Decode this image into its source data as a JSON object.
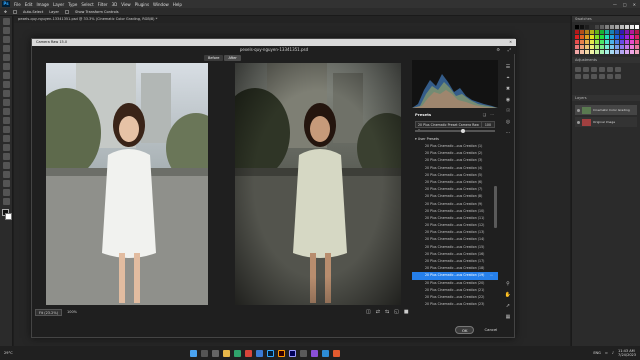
{
  "menu": {
    "logo": "Ps",
    "items": [
      "File",
      "Edit",
      "Image",
      "Layer",
      "Type",
      "Select",
      "Filter",
      "3D",
      "View",
      "Plugins",
      "Window",
      "Help"
    ]
  },
  "optionsbar": {
    "items": [
      "Auto-Select",
      "Layer",
      "Show Transform Controls"
    ]
  },
  "document_tab": "pexels-quy-nguyen-13341351.psd @ 33.3% (Cinematic Color Grading, RGB/8) *",
  "camera_raw": {
    "window_title": "Camera Raw 15.0",
    "file_name": "pexels-quy-nguyen-13341351.psd",
    "before_label": "Before",
    "after_label": "After",
    "zoom_fit": "Fit (23.2%)",
    "zoom_pct": "100%",
    "presets_title": "Presets",
    "preset_selected": "20 Plus Cinematic Preset Camera Raw B",
    "preset_amount": "100",
    "group_label": "User Presets",
    "presets": [
      {
        "label": "20 Plus Cinematic...ous Creation (1)",
        "selected": false
      },
      {
        "label": "20 Plus Cinematic...ous Creation (2)",
        "selected": false
      },
      {
        "label": "20 Plus Cinematic...ous Creation (3)",
        "selected": false
      },
      {
        "label": "20 Plus Cinematic...ous Creation (4)",
        "selected": false
      },
      {
        "label": "20 Plus Cinematic...ous Creation (5)",
        "selected": false
      },
      {
        "label": "20 Plus Cinematic...ous Creation (6)",
        "selected": false
      },
      {
        "label": "20 Plus Cinematic...ous Creation (7)",
        "selected": false
      },
      {
        "label": "20 Plus Cinematic...ous Creation (8)",
        "selected": false
      },
      {
        "label": "20 Plus Cinematic...ous Creation (9)",
        "selected": false
      },
      {
        "label": "20 Plus Cinematic...ous Creation (10)",
        "selected": false
      },
      {
        "label": "20 Plus Cinematic...ous Creation (11)",
        "selected": false
      },
      {
        "label": "20 Plus Cinematic...ous Creation (12)",
        "selected": false
      },
      {
        "label": "20 Plus Cinematic...ous Creation (13)",
        "selected": false
      },
      {
        "label": "20 Plus Cinematic...ous Creation (14)",
        "selected": false
      },
      {
        "label": "20 Plus Cinematic...ous Creation (15)",
        "selected": false
      },
      {
        "label": "20 Plus Cinematic...ous Creation (16)",
        "selected": false
      },
      {
        "label": "20 Plus Cinematic...ous Creation (17)",
        "selected": false
      },
      {
        "label": "20 Plus Cinematic...ous Creation (18)",
        "selected": false
      },
      {
        "label": "20 Plus Cinematic...ous Creation (19)",
        "selected": true
      },
      {
        "label": "20 Plus Cinematic...ous Creation (20)",
        "selected": false
      },
      {
        "label": "20 Plus Cinematic...ous Creation (21)",
        "selected": false
      },
      {
        "label": "20 Plus Cinematic...ous Creation (22)",
        "selected": false
      },
      {
        "label": "20 Plus Cinematic...ous Creation (23)",
        "selected": false
      }
    ],
    "ok_label": "OK",
    "cancel_label": "Cancel"
  },
  "right_panels": {
    "swatches_title": "Swatches",
    "adjustments_title": "Adjustments",
    "layers_title": "Layers",
    "layers": [
      {
        "name": "Cinematic Color Grading",
        "selected": true
      },
      {
        "name": "Original Image",
        "selected": false
      }
    ]
  },
  "taskbar": {
    "weather": "29°C",
    "time": "11:43 AM",
    "date": "7/24/2023",
    "lang": "ENG"
  },
  "colors": {
    "accent": "#2680eb",
    "panel": "#2b2b2b",
    "dialog": "#1f1f1f"
  }
}
